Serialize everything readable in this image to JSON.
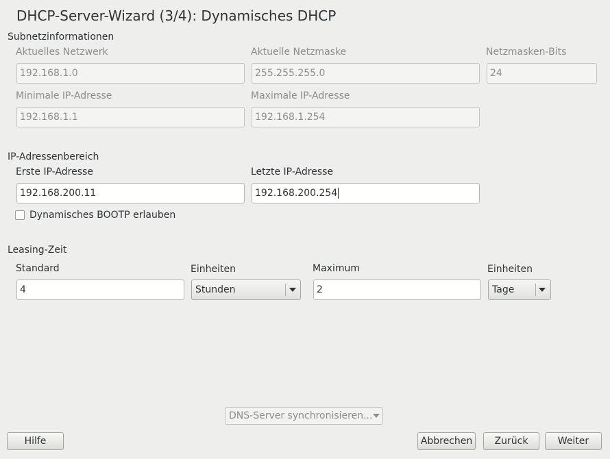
{
  "window": {
    "title": "DHCP-Server-Wizard (3/4): Dynamisches DHCP"
  },
  "subnet": {
    "heading": "Subnetzinformationen",
    "network": {
      "label": "Aktuelles Netzwerk",
      "value": "192.168.1.0"
    },
    "netmask": {
      "label": "Aktuelle Netzmaske",
      "value": "255.255.255.0"
    },
    "netmask_bits": {
      "label": "Netzmasken-Bits",
      "value": "24"
    },
    "min_ip": {
      "label": "Minimale IP-Adresse",
      "value": "192.168.1.1"
    },
    "max_ip": {
      "label": "Maximale IP-Adresse",
      "value": "192.168.1.254"
    }
  },
  "range": {
    "heading": "IP-Adressenbereich",
    "first_ip": {
      "label": "Erste IP-Adresse",
      "value": "192.168.200.11"
    },
    "last_ip": {
      "label": "Letzte IP-Adresse",
      "value": "192.168.200.254"
    },
    "bootp": {
      "label": "Dynamisches BOOTP erlauben",
      "checked": false
    }
  },
  "lease": {
    "heading": "Leasing-Zeit",
    "standard": {
      "label": "Standard",
      "value": "4"
    },
    "standard_units": {
      "label": "Einheiten",
      "selected": "Stunden"
    },
    "maximum": {
      "label": "Maximum",
      "value": "2"
    },
    "maximum_units": {
      "label": "Einheiten",
      "selected": "Tage"
    }
  },
  "dns_sync": {
    "label": "DNS-Server synchronisieren..."
  },
  "buttons": {
    "help": "Hilfe",
    "abort": "Abbrechen",
    "back": "Zurück",
    "next": "Weiter"
  }
}
